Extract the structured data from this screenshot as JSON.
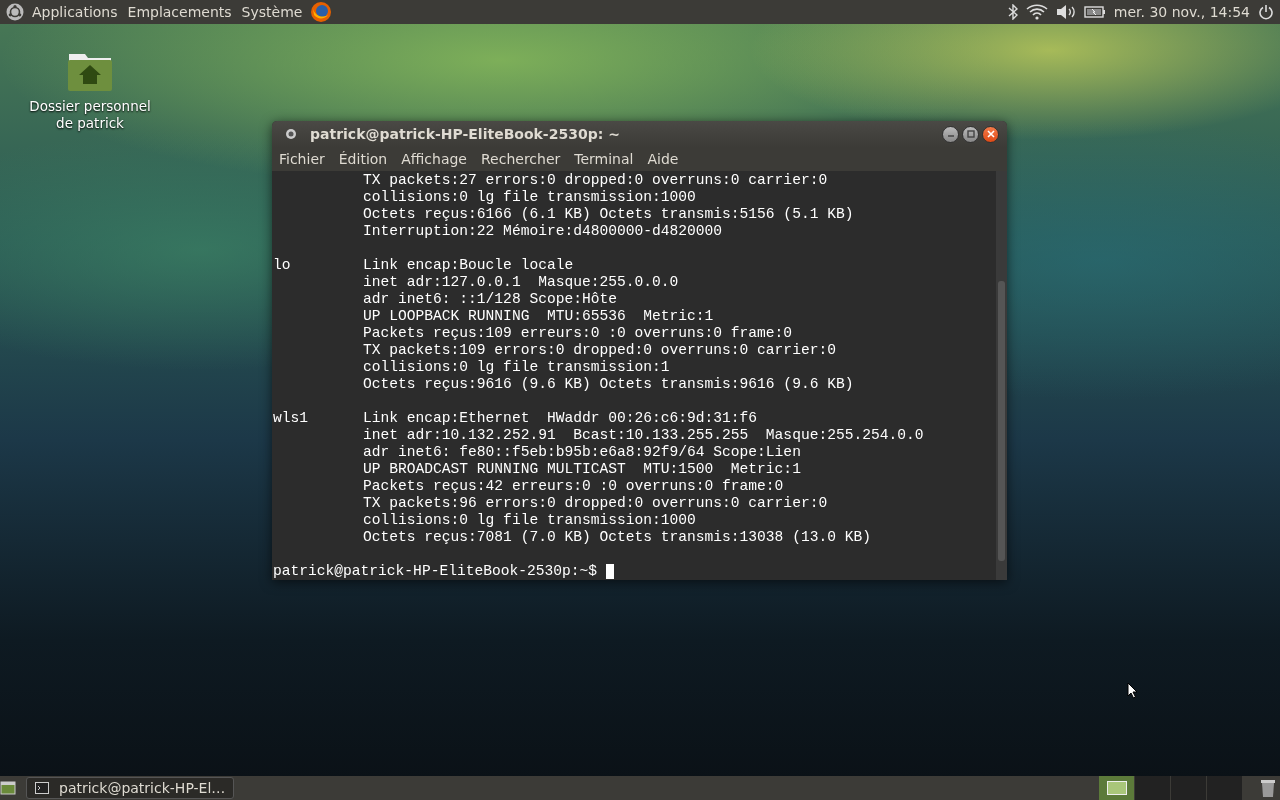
{
  "top_panel": {
    "menus": [
      "Applications",
      "Emplacements",
      "Système"
    ],
    "clock": "mer. 30 nov., 14:54"
  },
  "desktop_icons": [
    {
      "label": "Dossier personnel de patrick"
    }
  ],
  "terminal": {
    "title": "patrick@patrick-HP-EliteBook-2530p: ~",
    "menu": [
      "Fichier",
      "Édition",
      "Affichage",
      "Rechercher",
      "Terminal",
      "Aide"
    ],
    "blocks": [
      {
        "lines": [
          {
            "text": "TX packets:27 errors:0 dropped:0 overruns:0 carrier:0"
          },
          {
            "text": "collisions:0 lg file transmission:1000"
          },
          {
            "text": "Octets reçus:6166 (6.1 KB) Octets transmis:5156 (5.1 KB)"
          },
          {
            "text": "Interruption:22 Mémoire:d4800000-d4820000"
          }
        ]
      },
      {
        "lines": [
          {
            "iface": "lo",
            "text": "Link encap:Boucle locale"
          },
          {
            "text": "inet adr:127.0.0.1  Masque:255.0.0.0"
          },
          {
            "text": "adr inet6: ::1/128 Scope:Hôte"
          },
          {
            "text": "UP LOOPBACK RUNNING  MTU:65536  Metric:1"
          },
          {
            "text": "Packets reçus:109 erreurs:0 :0 overruns:0 frame:0"
          },
          {
            "text": "TX packets:109 errors:0 dropped:0 overruns:0 carrier:0"
          },
          {
            "text": "collisions:0 lg file transmission:1"
          },
          {
            "text": "Octets reçus:9616 (9.6 KB) Octets transmis:9616 (9.6 KB)"
          }
        ]
      },
      {
        "lines": [
          {
            "iface": "wls1",
            "text": "Link encap:Ethernet  HWaddr 00:26:c6:9d:31:f6"
          },
          {
            "text": "inet adr:10.132.252.91  Bcast:10.133.255.255  Masque:255.254.0.0"
          },
          {
            "text": "adr inet6: fe80::f5eb:b95b:e6a8:92f9/64 Scope:Lien"
          },
          {
            "text": "UP BROADCAST RUNNING MULTICAST  MTU:1500  Metric:1"
          },
          {
            "text": "Packets reçus:42 erreurs:0 :0 overruns:0 frame:0"
          },
          {
            "text": "TX packets:96 errors:0 dropped:0 overruns:0 carrier:0"
          },
          {
            "text": "collisions:0 lg file transmission:1000"
          },
          {
            "text": "Octets reçus:7081 (7.0 KB) Octets transmis:13038 (13.0 KB)"
          }
        ]
      }
    ],
    "prompt": "patrick@patrick-HP-EliteBook-2530p:~$"
  },
  "bottom_panel": {
    "tasks": [
      {
        "label": "patrick@patrick-HP-El…"
      }
    ],
    "workspaces": [
      {
        "selected": true
      },
      {
        "selected": false
      },
      {
        "selected": false
      },
      {
        "selected": false
      }
    ]
  }
}
